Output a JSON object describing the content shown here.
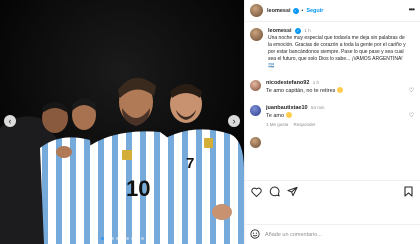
{
  "header": {
    "username": "leomessi",
    "separator": "•",
    "follow_label": "Seguir",
    "more_icon": "more-horizontal-icon"
  },
  "caption": {
    "username": "leomessi",
    "time": "1 h",
    "text": "Una noche muy especial que todavía me deja sin palabras de la emoción. Gracias de corazón a toda la gente por el cariño y por estar bancándonos siempre. Pase lo que pase y sea cual sea el futuro, que solo Dios lo sabe... ¡VAMOS ARGENTINA! 🇦🇷"
  },
  "comments": [
    {
      "username": "nicodestefano92",
      "time": "1 h",
      "text": "Te amo capitán, no te retires",
      "emoji": "crying-face",
      "likes": "",
      "reply_label": ""
    },
    {
      "username": "juanbautistae10",
      "time": "54 min",
      "text": "Te amo",
      "emoji": "heart-eyes-face",
      "likes": "1 Me gusta",
      "reply_label": "Responder"
    }
  ],
  "media": {
    "dots_count": 9,
    "active_dot": 0,
    "jersey_numbers": [
      "10",
      "7"
    ]
  },
  "actions": {
    "like_icon": "heart-icon",
    "comment_icon": "comment-icon",
    "share_icon": "share-icon",
    "save_icon": "bookmark-icon"
  },
  "add_comment": {
    "placeholder": "Añade un comentario..."
  },
  "colors": {
    "accent": "#0095f6",
    "jersey_blue": "#75aadb",
    "text": "#262626",
    "muted": "#8e8e8e"
  }
}
